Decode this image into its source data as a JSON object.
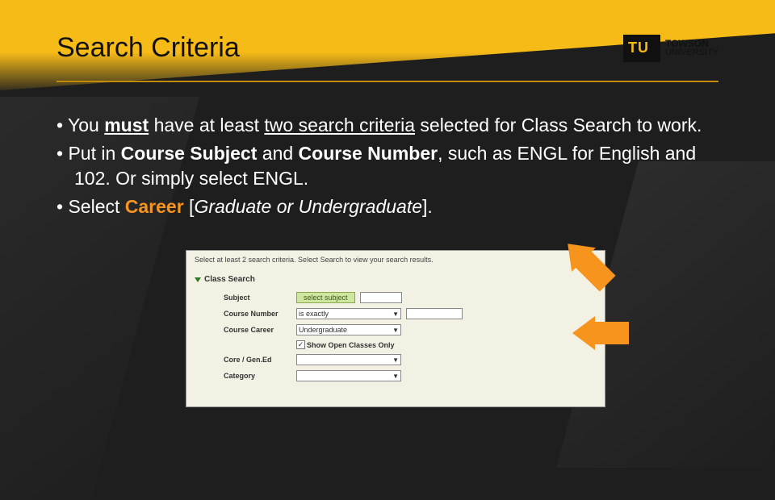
{
  "header": {
    "title": "Search Criteria",
    "logo_primary": "TOWSON",
    "logo_secondary": "UNIVERSITY"
  },
  "bullets": {
    "b1_pre": "You ",
    "b1_must": "must",
    "b1_mid": " have at least ",
    "b1_two": "two search criteria",
    "b1_post": " selected for Class Search to work.",
    "b2_pre": "Put in ",
    "b2_cs": "Course Subject",
    "b2_and": " and ",
    "b2_cn": "Course Number",
    "b2_post": ", such as ENGL for English and 102. Or simply select ENGL.",
    "b3_pre": "Select ",
    "b3_career": "Career",
    "b3_post_open": " [",
    "b3_italic": "Graduate or Undergraduate",
    "b3_post_close": "]."
  },
  "panel": {
    "instruction": "Select at least 2 search criteria. Select Search to view your search results.",
    "section": "Class Search",
    "labels": {
      "subject": "Subject",
      "course_number": "Course Number",
      "course_career": "Course Career",
      "core_gened": "Core / Gen.Ed",
      "category": "Category"
    },
    "controls": {
      "select_subject_btn": "select subject",
      "is_exactly": "is exactly",
      "undergraduate": "Undergraduate",
      "show_open": "Show Open Classes Only",
      "checked": "✓"
    }
  }
}
